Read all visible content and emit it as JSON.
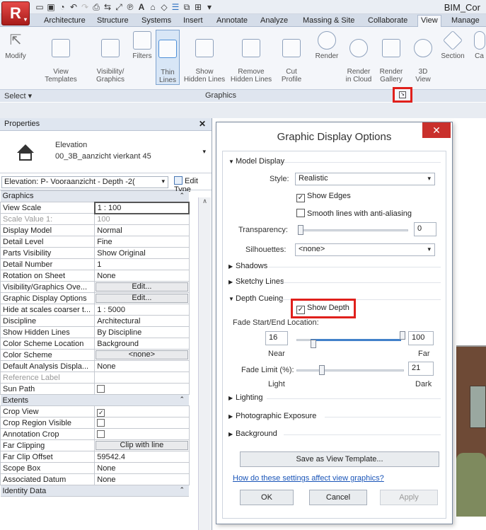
{
  "app": {
    "logo": "R",
    "title": "BIM_Cor",
    "qat_icons": [
      "open-icon",
      "save-icon",
      "sync-icon",
      "undo-icon",
      "redo-icon",
      "measure-icon",
      "dimension-icon",
      "tag-icon",
      "text-icon",
      "3d-view-icon",
      "section-icon",
      "thin-lines-icon",
      "close-hidden-icon",
      "switch-windows-icon",
      "customize-icon"
    ]
  },
  "ribbon": {
    "tabs": [
      "Architecture",
      "Structure",
      "Systems",
      "Insert",
      "Annotate",
      "Analyze",
      "Massing & Site",
      "Collaborate",
      "View",
      "Manage"
    ],
    "active_tab": "View",
    "tools": {
      "modify": "Modify",
      "view_templates": "View\nTemplates",
      "visibility_graphics": "Visibility/\nGraphics",
      "filters": "Filters",
      "thin_lines": "Thin\nLines",
      "show_hidden_lines": "Show\nHidden Lines",
      "remove_hidden_lines": "Remove\nHidden Lines",
      "cut_profile": "Cut\nProfile",
      "render": "Render",
      "render_in_cloud": "Render\nin Cloud",
      "render_gallery": "Render\nGallery",
      "view_3d": "3D\nView",
      "section": "Section",
      "callout": "Ca"
    },
    "select_label": "Select",
    "panel_label": "Graphics"
  },
  "properties": {
    "header": "Properties",
    "close": "✕",
    "type_name": "Elevation",
    "type_sub": "00_3B_aanzicht vierkant 45",
    "instance": "Elevation: P- Vooraanzicht - Depth -2(",
    "edit_type": "Edit Type",
    "groups": [
      {
        "name": "Graphics",
        "rows": [
          {
            "n": "View Scale",
            "v": "1 : 100",
            "kind": "input"
          },
          {
            "n": "Scale Value    1:",
            "v": "100",
            "kind": "disabled"
          },
          {
            "n": "Display Model",
            "v": "Normal"
          },
          {
            "n": "Detail Level",
            "v": "Fine"
          },
          {
            "n": "Parts Visibility",
            "v": "Show Original"
          },
          {
            "n": "Detail Number",
            "v": "1"
          },
          {
            "n": "Rotation on Sheet",
            "v": "None"
          },
          {
            "n": "Visibility/Graphics Ove...",
            "v": "Edit...",
            "kind": "button"
          },
          {
            "n": "Graphic Display Options",
            "v": "Edit...",
            "kind": "button"
          },
          {
            "n": "Hide at scales coarser t...",
            "v": "1 : 5000"
          },
          {
            "n": "Discipline",
            "v": "Architectural"
          },
          {
            "n": "Show Hidden Lines",
            "v": "By Discipline"
          },
          {
            "n": "Color Scheme Location",
            "v": "Background"
          },
          {
            "n": "Color Scheme",
            "v": "<none>",
            "kind": "button"
          },
          {
            "n": "Default Analysis Displa...",
            "v": "None"
          },
          {
            "n": "Reference Label",
            "v": "",
            "kind": "disabled"
          },
          {
            "n": "Sun Path",
            "v": "",
            "kind": "checkbox",
            "checked": false
          }
        ]
      },
      {
        "name": "Extents",
        "rows": [
          {
            "n": "Crop View",
            "v": "",
            "kind": "checkbox",
            "checked": true
          },
          {
            "n": "Crop Region Visible",
            "v": "",
            "kind": "checkbox",
            "checked": false
          },
          {
            "n": "Annotation Crop",
            "v": "",
            "kind": "checkbox",
            "checked": false
          },
          {
            "n": "Far Clipping",
            "v": "Clip with line",
            "kind": "button"
          },
          {
            "n": "Far Clip Offset",
            "v": "59542.4"
          },
          {
            "n": "Scope Box",
            "v": "None"
          },
          {
            "n": "Associated Datum",
            "v": "None"
          }
        ]
      },
      {
        "name": "Identity Data",
        "rows": []
      }
    ]
  },
  "dialog": {
    "title": "Graphic Display Options",
    "close": "✕",
    "model_display": {
      "header": "Model Display",
      "style_label": "Style:",
      "style_value": "Realistic",
      "show_edges": "Show Edges",
      "show_edges_checked": true,
      "smooth_lines": "Smooth lines with anti-aliasing",
      "smooth_lines_checked": false,
      "transparency_label": "Transparency:",
      "transparency_value": "0",
      "transparency_level": 0,
      "silhouettes_label": "Silhouettes:",
      "silhouettes_value": "<none>"
    },
    "collapsed_sections": [
      "Shadows",
      "Sketchy Lines"
    ],
    "depth_cueing": {
      "header": "Depth Cueing",
      "show_depth": "Show Depth",
      "show_depth_checked": true,
      "fade_label": "Fade Start/End Location:",
      "start_value": "16",
      "end_value": "100",
      "near": "Near",
      "far": "Far",
      "fade_limit_label": "Fade Limit (%):",
      "fade_limit_value": "21",
      "light": "Light",
      "dark": "Dark"
    },
    "lower_sections": [
      "Lighting",
      "Photographic Exposure",
      "Background"
    ],
    "save_template": "Save as View Template...",
    "help_link": "How do these settings affect view graphics?",
    "ok": "OK",
    "cancel": "Cancel",
    "apply": "Apply"
  },
  "colors": {
    "highlight_red": "#e0201c",
    "accent_blue": "#4d8fd8",
    "app_red": "#c0302c"
  }
}
